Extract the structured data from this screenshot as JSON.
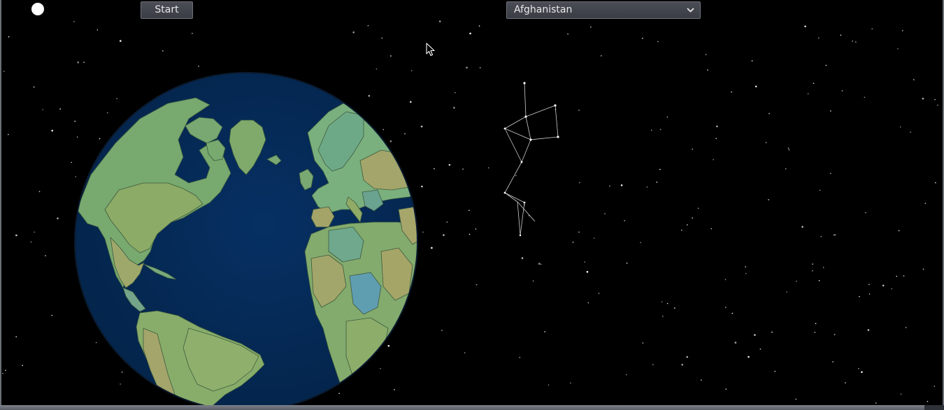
{
  "toolbar": {
    "start_label": "Start",
    "country_selected": "Afghanistan",
    "status_indicator_color": "#ffffff"
  },
  "icons": {
    "status": "circle-indicator",
    "dropdown": "chevron-down-icon",
    "cursor": "mouse-pointer-icon"
  },
  "scene": {
    "background_color": "#000000",
    "ocean_color": "#052a52",
    "land_colors": [
      "#74a877",
      "#8fa667",
      "#6ea791",
      "#a6a56a",
      "#5e9db0"
    ],
    "star_color": "#ffffff",
    "constellation_line_color": "#cfcfcf"
  }
}
